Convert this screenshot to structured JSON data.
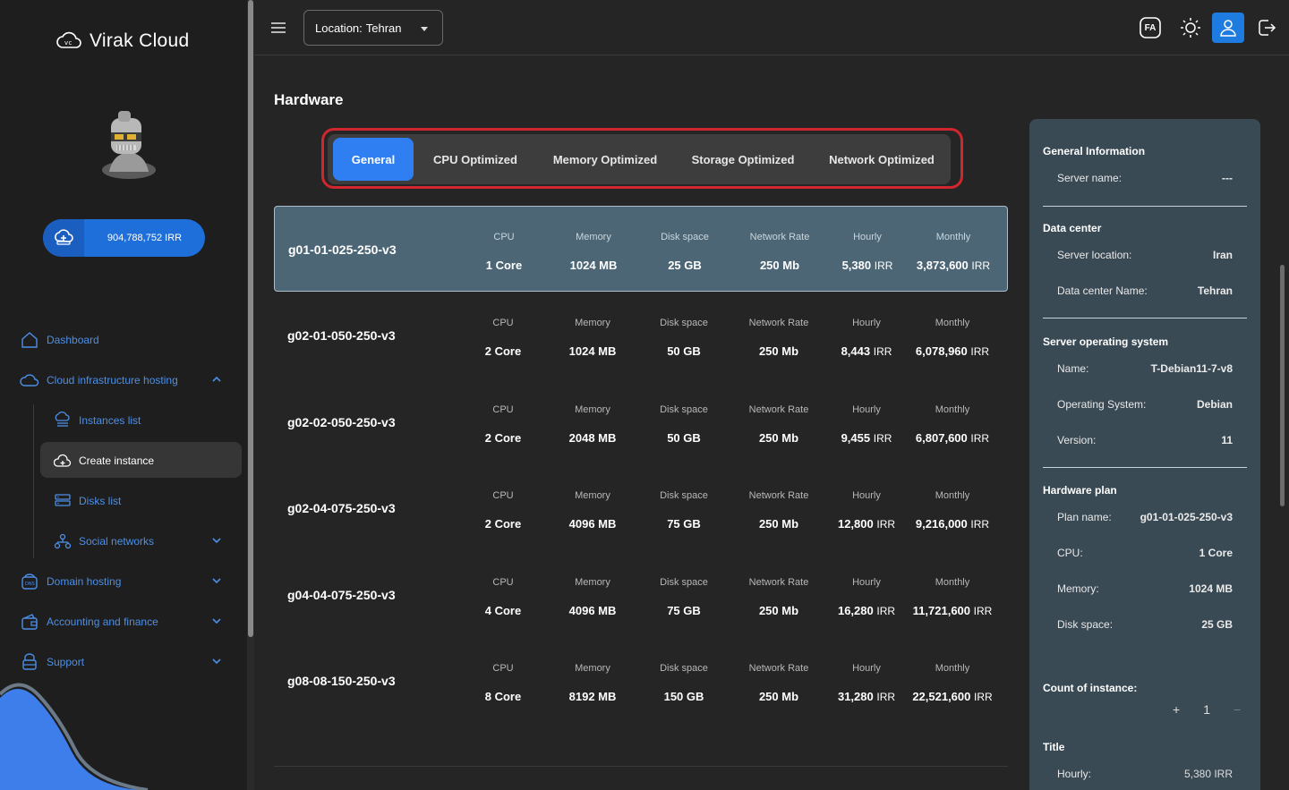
{
  "app": {
    "brand": "Virak Cloud",
    "balance": "904,788,752 IRR",
    "accent": "#2f7ff2",
    "highlight_color": "#d0262d"
  },
  "sidebar": {
    "items": [
      {
        "label": "Dashboard",
        "icon": "home-icon"
      },
      {
        "label": "Cloud infrastructure hosting",
        "icon": "cloud-icon",
        "expanded": true
      },
      {
        "label": "Instances list",
        "icon": "server-list-icon"
      },
      {
        "label": "Create instance",
        "icon": "cloud-add-icon",
        "active": true
      },
      {
        "label": "Disks list",
        "icon": "disk-icon"
      },
      {
        "label": "Social networks",
        "icon": "network-icon"
      },
      {
        "label": "Domain hosting",
        "icon": "domain-icon"
      },
      {
        "label": "Accounting and finance",
        "icon": "wallet-icon"
      },
      {
        "label": "Support",
        "icon": "support-icon"
      }
    ]
  },
  "header": {
    "location_label": "Location:",
    "location_value": "Tehran",
    "lang_label": "FA"
  },
  "hardware": {
    "title": "Hardware",
    "tabs": [
      "General",
      "CPU Optimized",
      "Memory Optimized",
      "Storage Optimized",
      "Network Optimized"
    ],
    "active_tab": "General",
    "columns": [
      "CPU",
      "Memory",
      "Disk space",
      "Network Rate",
      "Hourly",
      "Monthly"
    ],
    "plans": [
      {
        "name": "g01-01-025-250-v3",
        "cpu": "1 Core",
        "memory": "1024 MB",
        "disk": "25 GB",
        "network": "250 Mb",
        "hourly": "5,380",
        "monthly": "3,873,600",
        "currency": "IRR",
        "selected": true
      },
      {
        "name": "g02-01-050-250-v3",
        "cpu": "2 Core",
        "memory": "1024 MB",
        "disk": "50 GB",
        "network": "250 Mb",
        "hourly": "8,443",
        "monthly": "6,078,960",
        "currency": "IRR"
      },
      {
        "name": "g02-02-050-250-v3",
        "cpu": "2 Core",
        "memory": "2048 MB",
        "disk": "50 GB",
        "network": "250 Mb",
        "hourly": "9,455",
        "monthly": "6,807,600",
        "currency": "IRR"
      },
      {
        "name": "g02-04-075-250-v3",
        "cpu": "2 Core",
        "memory": "4096 MB",
        "disk": "75 GB",
        "network": "250 Mb",
        "hourly": "12,800",
        "monthly": "9,216,000",
        "currency": "IRR"
      },
      {
        "name": "g04-04-075-250-v3",
        "cpu": "4 Core",
        "memory": "4096 MB",
        "disk": "75 GB",
        "network": "250 Mb",
        "hourly": "16,280",
        "monthly": "11,721,600",
        "currency": "IRR"
      },
      {
        "name": "g08-08-150-250-v3",
        "cpu": "8 Core",
        "memory": "8192 MB",
        "disk": "150 GB",
        "network": "250 Mb",
        "hourly": "31,280",
        "monthly": "22,521,600",
        "currency": "IRR"
      }
    ]
  },
  "summary": {
    "general_title": "General Information",
    "server_name_label": "Server name:",
    "server_name_value": "---",
    "dc_title": "Data center",
    "server_location_label": "Server location:",
    "server_location_value": "Iran",
    "dc_name_label": "Data center Name:",
    "dc_name_value": "Tehran",
    "os_title": "Server operating system",
    "os_name_label": "Name:",
    "os_name_value": "T-Debian11-7-v8",
    "os_label": "Operating System:",
    "os_value": "Debian",
    "version_label": "Version:",
    "version_value": "11",
    "hw_title": "Hardware plan",
    "plan_name_label": "Plan name:",
    "plan_name_value": "g01-01-025-250-v3",
    "cpu_label": "CPU:",
    "cpu_value": "1 Core",
    "memory_label": "Memory:",
    "memory_value": "1024 MB",
    "disk_label": "Disk space:",
    "disk_value": "25 GB",
    "count_title": "Count of instance:",
    "count_value": "1",
    "plus": "+",
    "minus": "−",
    "title_label": "Title",
    "hourly_label": "Hourly:",
    "hourly_value": "5,380 IRR"
  }
}
